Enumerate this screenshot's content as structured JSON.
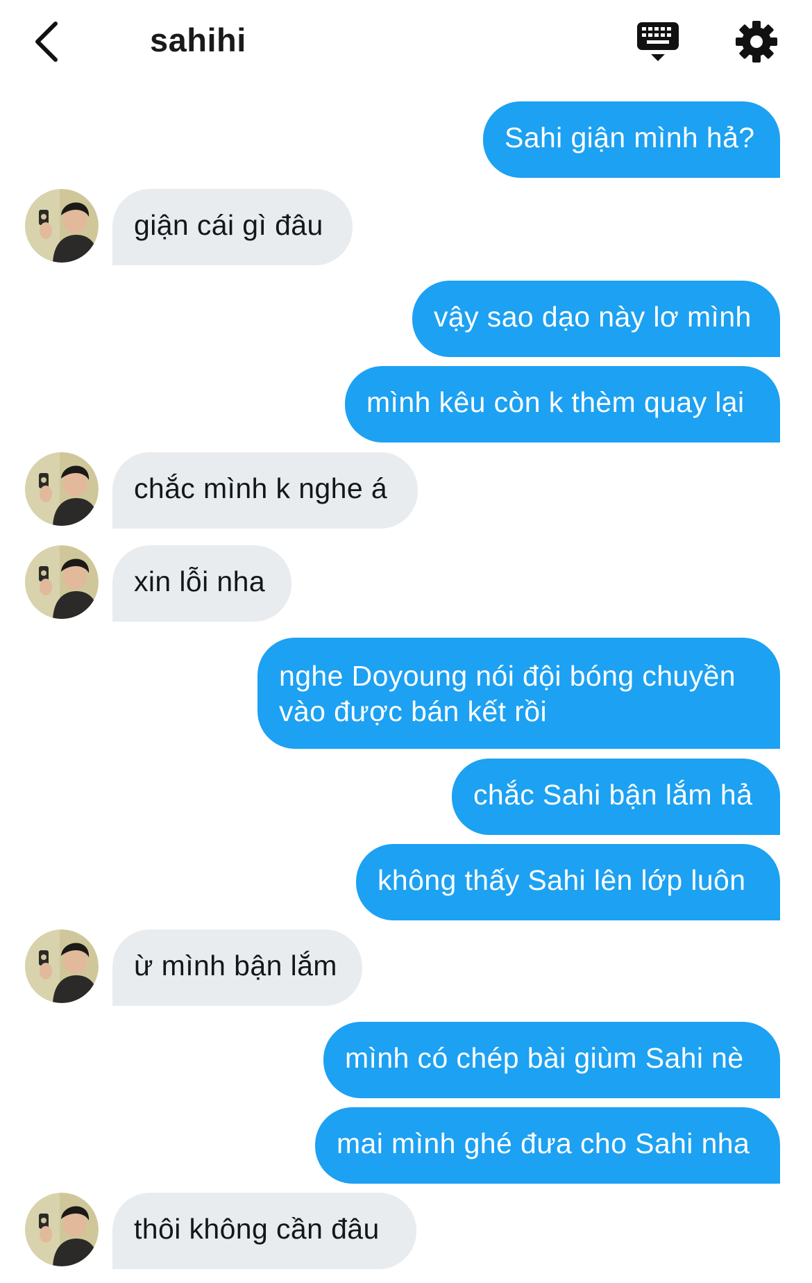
{
  "header": {
    "title": "sahihi",
    "back_icon": "chevron-left-icon",
    "keyboard_icon": "keyboard-icon",
    "settings_icon": "gear-icon"
  },
  "colors": {
    "sent_bubble": "#1da1f2",
    "received_bubble": "#e9ecef",
    "sent_text": "#ffffff",
    "received_text": "#14171a"
  },
  "messages": [
    {
      "from": "me",
      "text": "Sahi giận mình hả?"
    },
    {
      "from": "sahihi",
      "text": "giận cái gì đâu"
    },
    {
      "from": "me",
      "text": "vậy sao dạo này lơ mình"
    },
    {
      "from": "me",
      "text": "mình kêu còn k thèm quay lại"
    },
    {
      "from": "sahihi",
      "text": "chắc mình k nghe á"
    },
    {
      "from": "sahihi",
      "text": "xin lỗi nha"
    },
    {
      "from": "me",
      "text": "nghe Doyoung nói đội bóng chuyền vào được bán kết rồi"
    },
    {
      "from": "me",
      "text": "chắc Sahi bận lắm hả"
    },
    {
      "from": "me",
      "text": "không thấy Sahi lên lớp luôn"
    },
    {
      "from": "sahihi",
      "text": "ừ mình bận lắm"
    },
    {
      "from": "me",
      "text": "mình có chép bài giùm Sahi nè"
    },
    {
      "from": "me",
      "text": "mai mình ghé đưa cho Sahi nha"
    },
    {
      "from": "sahihi",
      "text": "thôi không cần đâu"
    }
  ]
}
